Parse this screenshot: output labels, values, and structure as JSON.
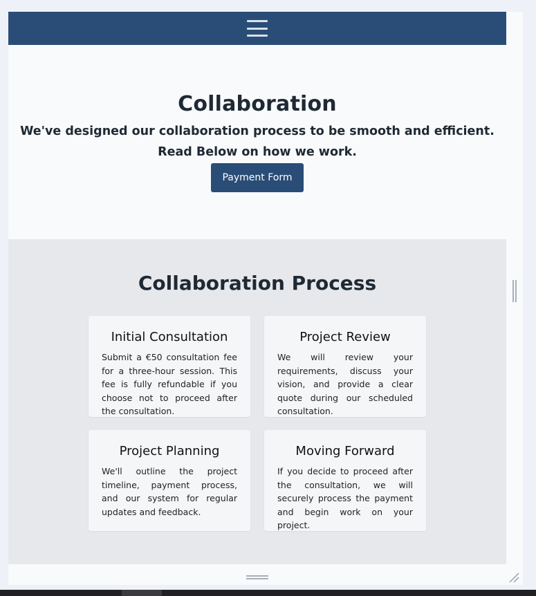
{
  "nav": {
    "menu_icon": "hamburger-menu-icon"
  },
  "hero": {
    "title": "Collaboration",
    "subtitle_line1": "We've designed our collaboration process to be smooth and efficient.",
    "subtitle_line2": "Read Below on how we work.",
    "button_label": "Payment Form"
  },
  "process": {
    "title": "Collaboration Process",
    "cards": [
      {
        "title": "Initial Consultation",
        "text": "Submit a €50 consultation fee for a three-hour session. This fee is fully refundable if you choose not to proceed after the consultation."
      },
      {
        "title": "Project Review",
        "text": "We will review your requirements, discuss your vision, and provide a clear quote during our scheduled consultation."
      },
      {
        "title": "Project Planning",
        "text": "We'll outline the project timeline, payment process, and our system for regular updates and feedback."
      },
      {
        "title": "Moving Forward",
        "text": "If you decide to proceed after the consultation, we will securely process the payment and begin work on your project."
      }
    ]
  },
  "colors": {
    "brand": "#2a4d77",
    "page_bg": "#f8fafc",
    "section_bg": "#e6e8ec",
    "card_bg": "#f5f6f8"
  }
}
